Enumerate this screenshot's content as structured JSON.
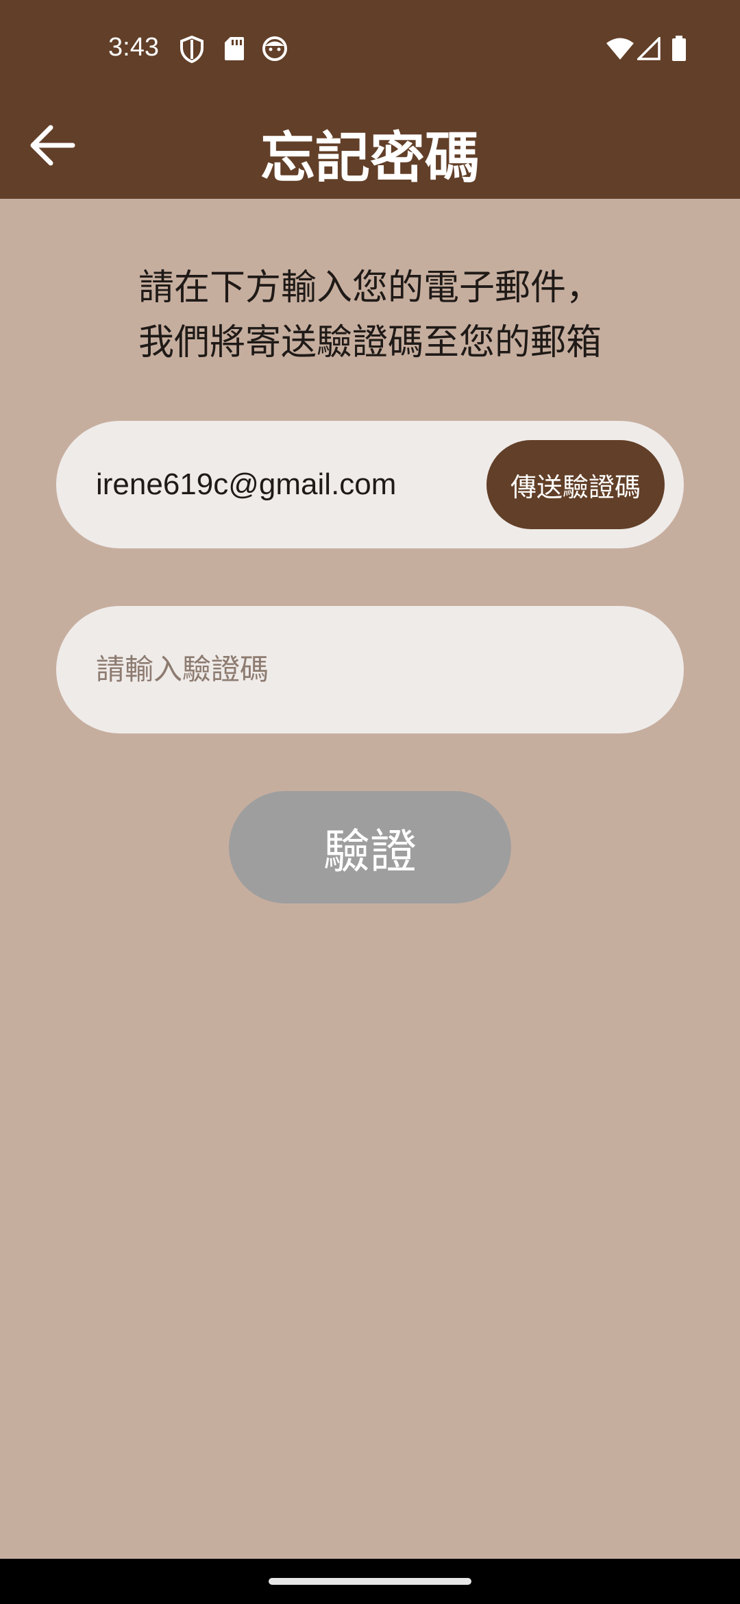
{
  "status_bar": {
    "time": "3:43",
    "icons_left": [
      "shield-icon",
      "sd-card-icon",
      "face-icon"
    ],
    "icons_right": [
      "wifi-icon",
      "signal-icon",
      "battery-icon"
    ]
  },
  "app_bar": {
    "title": "忘記密碼",
    "back_icon": "arrow-left-icon"
  },
  "instruction": {
    "line1": "請在下方輸入您的電子郵件，",
    "line2": "我們將寄送驗證碼至您的郵箱"
  },
  "email_field": {
    "value": "irene619c@gmail.com",
    "send_button_label": "傳送驗證碼"
  },
  "code_field": {
    "value": "",
    "placeholder": "請輸入驗證碼"
  },
  "verify_button": {
    "label": "驗證"
  },
  "colors": {
    "primary": "#623f28",
    "background": "#c6ae9f",
    "field": "#efebe9",
    "disabled_button": "#9e9e9e"
  }
}
